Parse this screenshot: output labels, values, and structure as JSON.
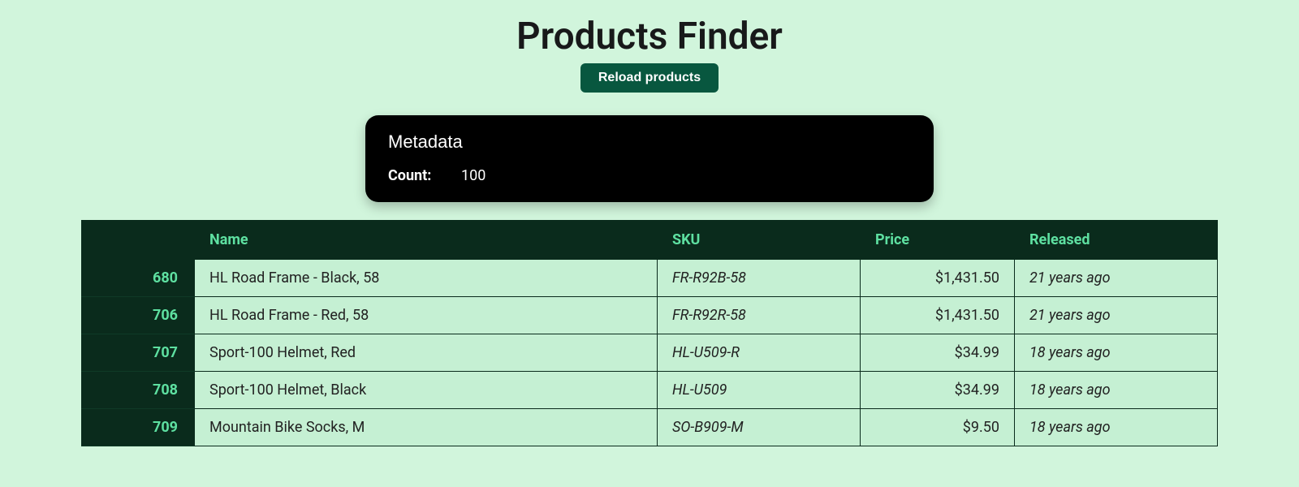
{
  "title": "Products Finder",
  "reload_label": "Reload products",
  "metadata": {
    "heading": "Metadata",
    "count_label": "Count:",
    "count_value": "100"
  },
  "columns": {
    "id": "",
    "name": "Name",
    "sku": "SKU",
    "price": "Price",
    "released": "Released"
  },
  "rows": [
    {
      "id": "680",
      "name": "HL Road Frame - Black, 58",
      "sku": "FR-R92B-58",
      "price": "$1,431.50",
      "released": "21 years ago"
    },
    {
      "id": "706",
      "name": "HL Road Frame - Red, 58",
      "sku": "FR-R92R-58",
      "price": "$1,431.50",
      "released": "21 years ago"
    },
    {
      "id": "707",
      "name": "Sport-100 Helmet, Red",
      "sku": "HL-U509-R",
      "price": "$34.99",
      "released": "18 years ago"
    },
    {
      "id": "708",
      "name": "Sport-100 Helmet, Black",
      "sku": "HL-U509",
      "price": "$34.99",
      "released": "18 years ago"
    },
    {
      "id": "709",
      "name": "Mountain Bike Socks, M",
      "sku": "SO-B909-M",
      "price": "$9.50",
      "released": "18 years ago"
    }
  ]
}
